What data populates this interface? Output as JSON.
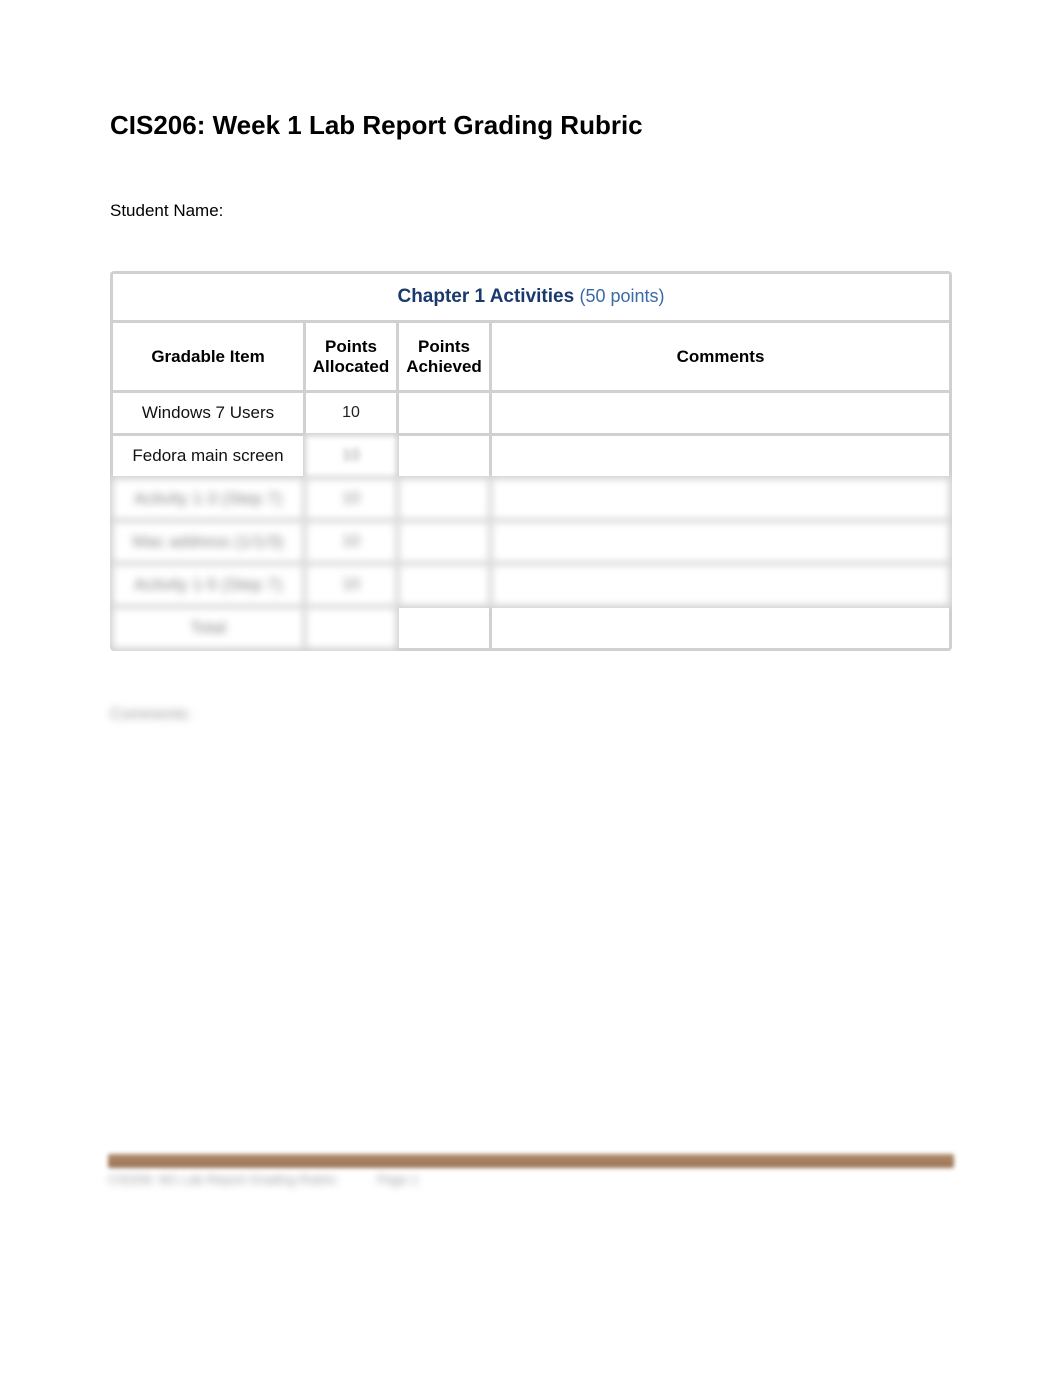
{
  "title": "CIS206: Week 1 Lab Report Grading Rubric",
  "student_name_label": "Student Name:",
  "section": {
    "title": "Chapter 1 Activities",
    "points_label": "(50 points)"
  },
  "columns": {
    "item": "Gradable Item",
    "allocated": "Points Allocated",
    "achieved": "Points Achieved",
    "comments": "Comments"
  },
  "rows": [
    {
      "item": "Windows 7 Users",
      "allocated": "10",
      "achieved": "",
      "comments": ""
    },
    {
      "item": "Fedora main screen",
      "allocated": "10",
      "achieved": "",
      "comments": ""
    },
    {
      "item": "Activity 1-3 (Step 7)",
      "allocated": "10",
      "achieved": "",
      "comments": ""
    },
    {
      "item": "Mac address (1/1/3)",
      "allocated": "10",
      "achieved": "",
      "comments": ""
    },
    {
      "item": "Activity 1-5 (Step 7)",
      "allocated": "10",
      "achieved": "",
      "comments": ""
    },
    {
      "item": "Total",
      "allocated": "",
      "achieved": "",
      "comments": ""
    }
  ],
  "comments_label": "Comments:",
  "footer": {
    "left": "CIS206: W1 Lab Report Grading Rubric",
    "right": "Page 1"
  }
}
